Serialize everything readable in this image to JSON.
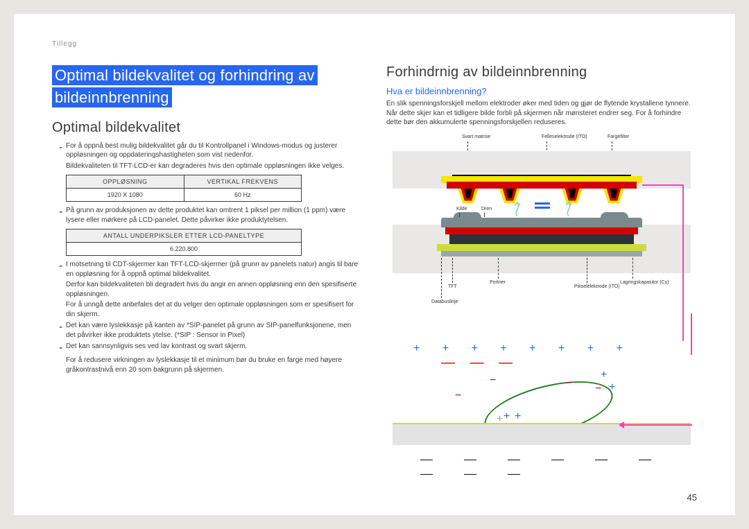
{
  "header": {
    "label": "Tillegg"
  },
  "page_number": "45",
  "left": {
    "title": "Optimal bildekvalitet og forhindring av bildeinnbrenning",
    "section": "Optimal bildekvalitet",
    "b1": "For å oppnå best mulig bildekvalitet går du til Kontrollpanel i Windows-modus og justerer oppløsningen og oppdateringshastigheten som vist nedenfor.",
    "b1_sub": "Bildekvaliteten til TFT-LCD-er kan degraderes hvis den optimale oppløsningen ikke velges.",
    "tbl1": {
      "h1": "OPPLØSNING",
      "h2": "VERTIKAL FREKVENS",
      "r1c1": "1920 X 1080",
      "r1c2": "60 Hz"
    },
    "b2": "På grunn av produksjonen av dette produktet kan omtrent 1 piksel per million (1 ppm) være lysere eller mørkere på LCD-panelet. Dette påvirker ikke produktytelsen.",
    "tbl2": {
      "h": "ANTALL UNDERPIKSLER ETTER LCD-PANELTYPE",
      "v": "6.220.800"
    },
    "b3": "I motsetning til CDT-skjermer kan TFT-LCD-skjermer (på grunn av panelets natur) angis til bare en oppløsning for å oppnå optimal bildekvalitet.",
    "b3_sub1": "Derfor kan bildekvaliteten bli degradert hvis du angir en annen oppløsning enn den spesifiserte oppløsningen.",
    "b3_sub2": "For å unngå dette anbefales det at du velger den optimale oppløsningen som er spesifisert for din skjerm.",
    "b4": "Det kan være lyslekkasje på kanten av *SIP-panelet på grunn av SIP-panelfunksjonene, men det påvirker ikke produktets ytelse. (*SIP : Sensor in Pixel)",
    "b5": "Det kan sannsynligvis ses ved lav kontrast og svart skjerm.",
    "b5_sub": "For å redusere virkningen av lyslekkasje til et minimum bør du bruke en farge med høyere gråkontrastnivå enn 20 som bakgrunn på skjermen."
  },
  "right": {
    "section": "Forhindrnig av bildeinnbrenning",
    "sub": "Hva er bildeinnbrenning?",
    "p": "En slik spenningsforskjell mellom elektroder øker med tiden og gjør de flytende krystallene tynnere. Når dette skjer kan et tidligere bilde forbli på skjermen når mønsteret endrer seg. For å forhindre dette bør den akkumulerte spenningsforskjellen reduseres.",
    "labels": {
      "svart_matrise": "Svart matrise",
      "felleselektrode": "Felleselektrode (ITO)",
      "fargefilter": "Fargefilter",
      "kilde": "Kilde",
      "dren": "Dren",
      "tft": "TFT",
      "portner": "Portner",
      "pikselelektrode": "Pikselelektrode (ITO)",
      "lagringskapasitor": "Lagringskapasitor (Cs)",
      "databuslinje": "Databuslinje"
    }
  }
}
